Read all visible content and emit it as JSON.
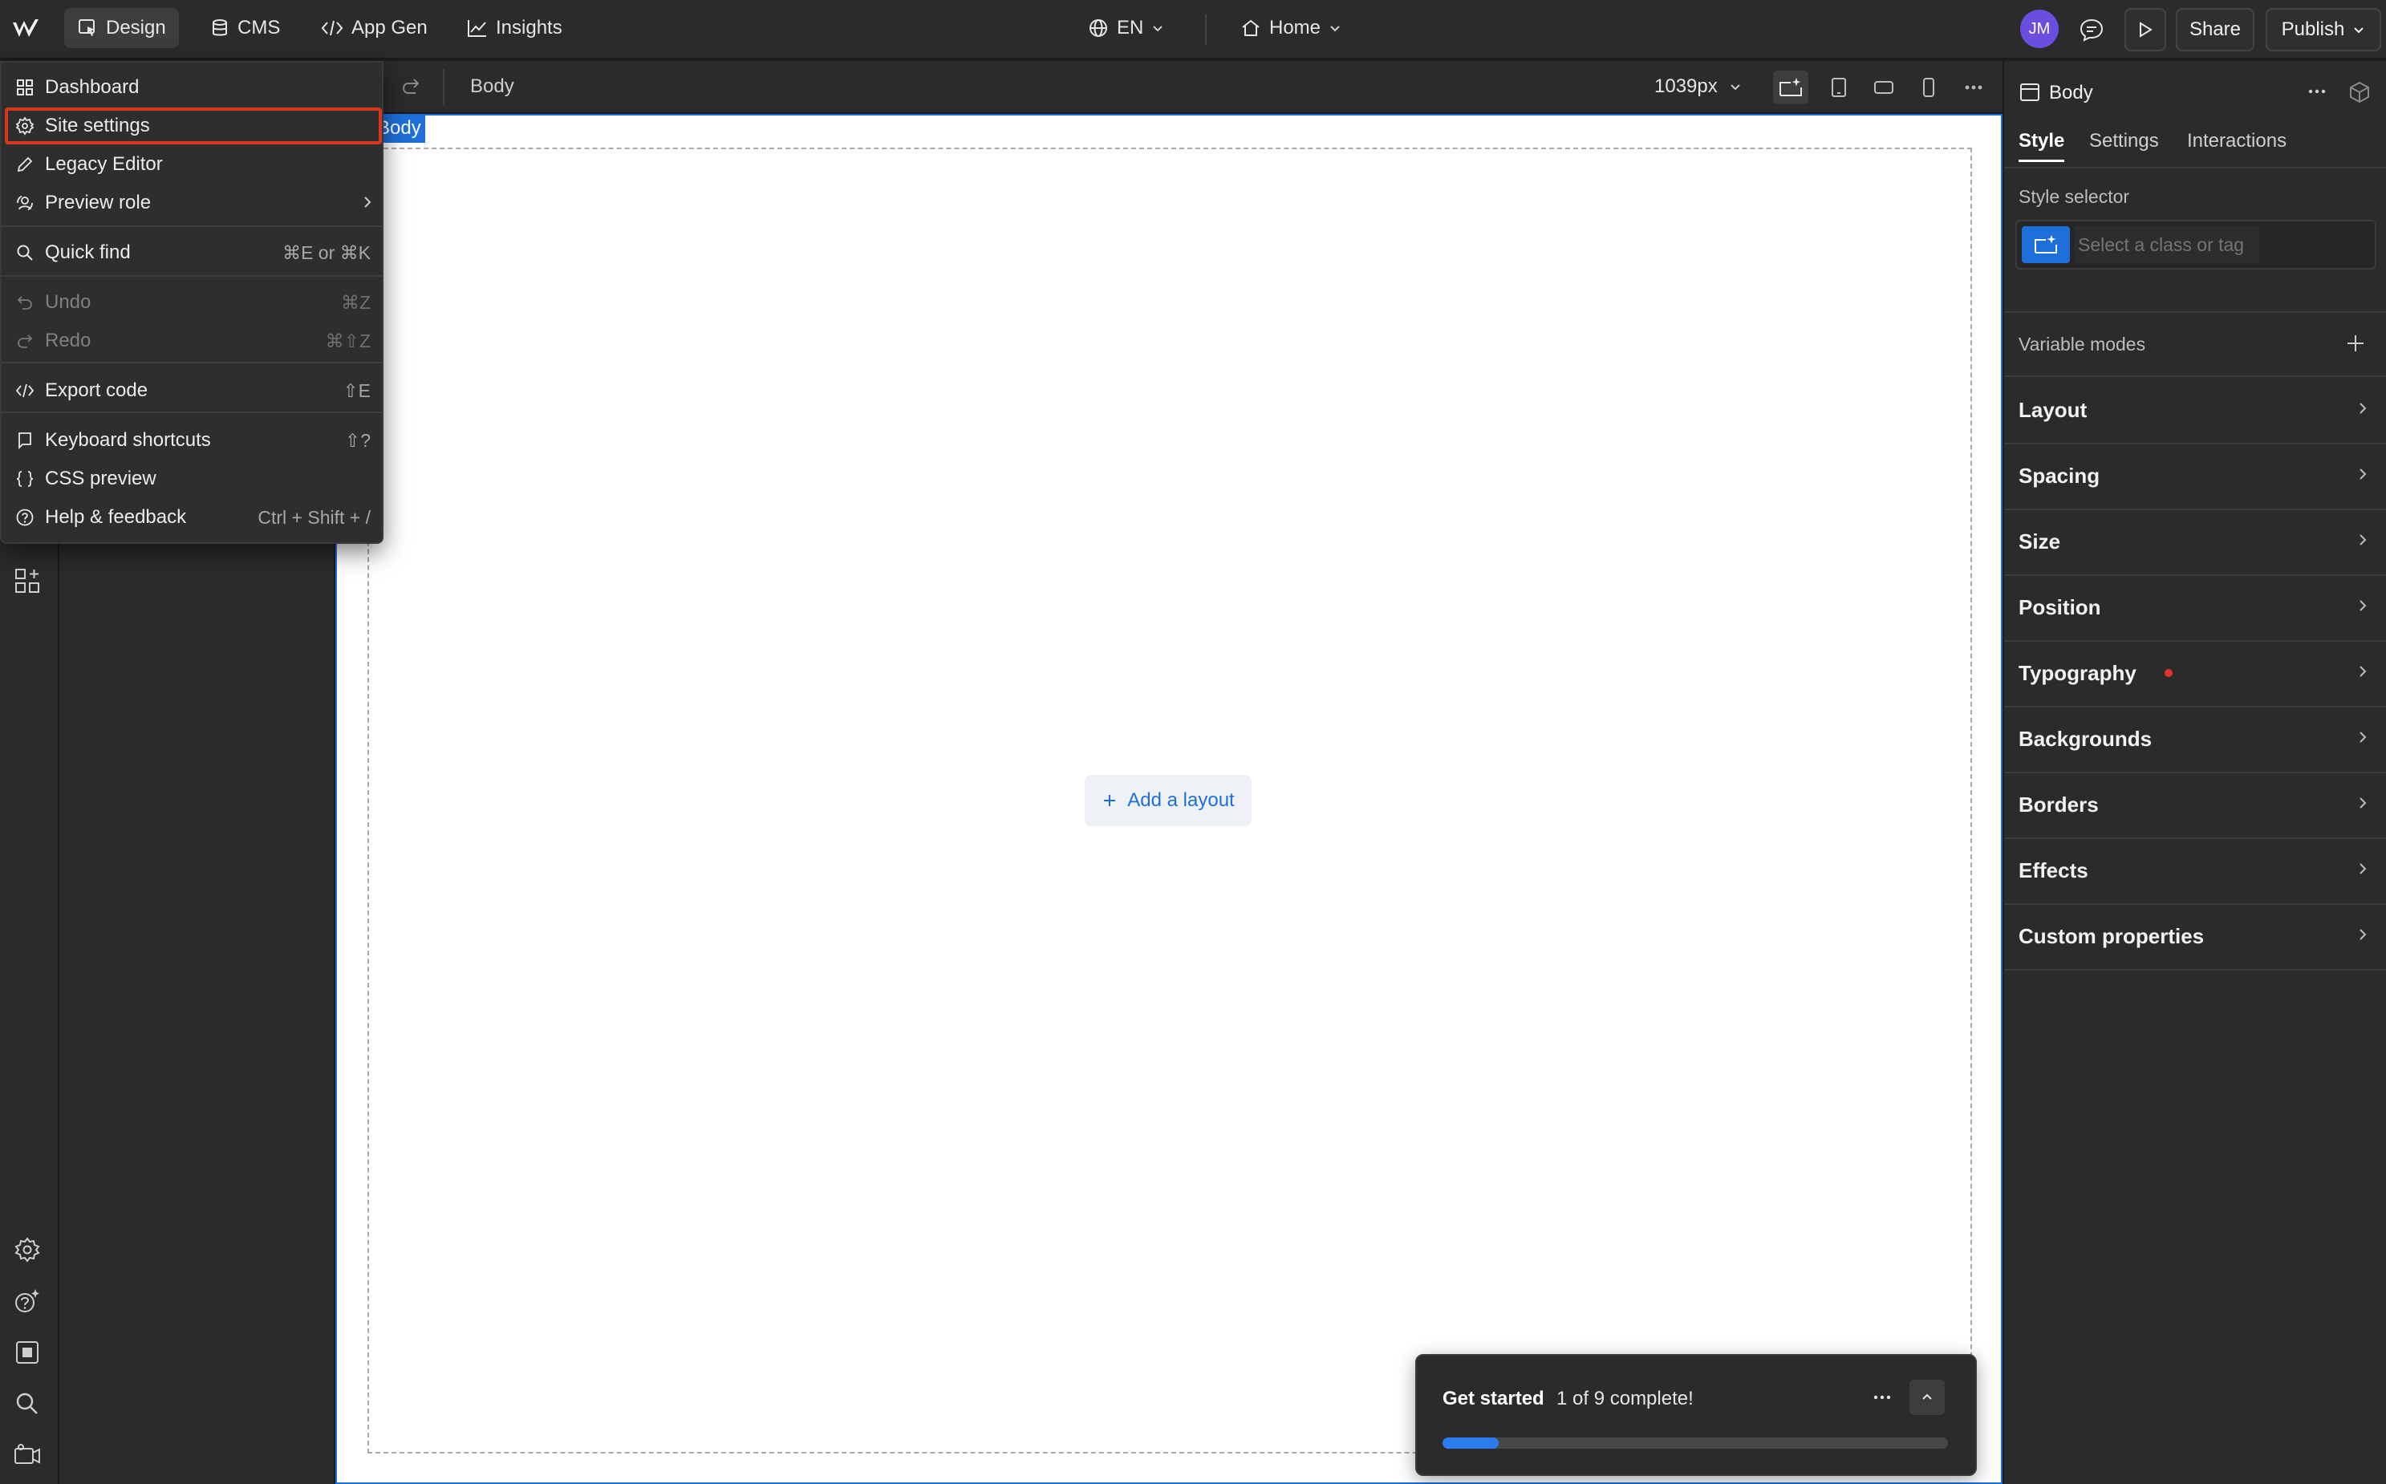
{
  "topbar": {
    "tabs": [
      {
        "label": "Design",
        "icon": "design-cursor-icon"
      },
      {
        "label": "CMS",
        "icon": "database-icon"
      },
      {
        "label": "App Gen",
        "icon": "code-icon"
      },
      {
        "label": "Insights",
        "icon": "chart-line-icon"
      }
    ],
    "locale": "EN",
    "page": "Home",
    "avatar_initials": "JM",
    "share_label": "Share",
    "publish_label": "Publish"
  },
  "canvasbar": {
    "breadcrumb": "Body",
    "width_value": "1039px"
  },
  "canvas": {
    "body_tag": "Body",
    "add_layout_label": "Add a layout"
  },
  "menu": {
    "items": [
      {
        "label": "Dashboard",
        "icon": "grid-icon",
        "shortcut": ""
      },
      {
        "label": "Site settings",
        "icon": "gear-icon",
        "shortcut": "",
        "highlighted": true
      },
      {
        "label": "Legacy Editor",
        "icon": "pencil-icon",
        "shortcut": ""
      },
      {
        "label": "Preview role",
        "icon": "user-switch-icon",
        "shortcut": "",
        "submenu": true
      },
      {
        "label": "Quick find",
        "icon": "search-icon",
        "shortcut": "⌘E or ⌘K"
      },
      {
        "label": "Undo",
        "icon": "undo-icon",
        "shortcut": "⌘Z",
        "disabled": true
      },
      {
        "label": "Redo",
        "icon": "redo-icon",
        "shortcut": "⌘⇧Z",
        "disabled": true
      },
      {
        "label": "Export code",
        "icon": "code-icon",
        "shortcut": "⇧E"
      },
      {
        "label": "Keyboard shortcuts",
        "icon": "keyboard-icon",
        "shortcut": "⇧?"
      },
      {
        "label": "CSS preview",
        "icon": "braces-icon",
        "shortcut": ""
      },
      {
        "label": "Help & feedback",
        "icon": "help-icon",
        "shortcut": "Ctrl + Shift + /"
      }
    ]
  },
  "rightpanel": {
    "element_label": "Body",
    "tabs": [
      "Style",
      "Settings",
      "Interactions"
    ],
    "style_selector_label": "Style selector",
    "style_selector_placeholder": "Select a class or tag",
    "variable_modes_label": "Variable modes",
    "sections": [
      "Layout",
      "Spacing",
      "Size",
      "Position",
      "Typography",
      "Backgrounds",
      "Borders",
      "Effects",
      "Custom properties"
    ]
  },
  "toast": {
    "title": "Get started",
    "progress_text": "1 of 9 complete!",
    "progress_fraction": 0.111
  },
  "colors": {
    "accent": "#1e6fd9",
    "highlight_outline": "#d9361e",
    "typography_dot": "#e0352b"
  }
}
